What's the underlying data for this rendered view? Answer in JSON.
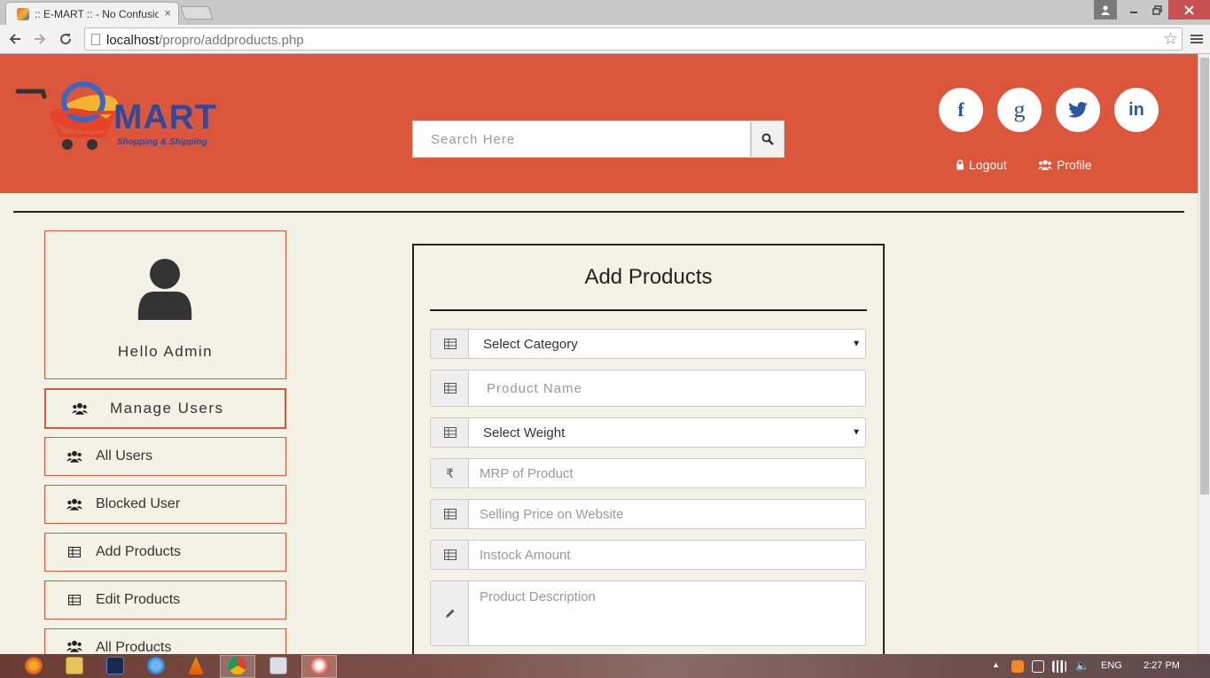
{
  "browser": {
    "tab_title": ":: E-MART :: - No Confusion",
    "tab_close": "×",
    "url_host": "localhost",
    "url_path": "/propro/addproducts.php"
  },
  "header": {
    "logo_text": "MART",
    "logo_tagline": "Shopping & Shipping",
    "search_placeholder": "Search Here",
    "social": {
      "facebook": "f",
      "google": "g",
      "linkedin": "in"
    },
    "logout_label": "Logout",
    "profile_label": "Profile"
  },
  "sidebar": {
    "greeting": "Hello Admin",
    "manage_label": "Manage Users",
    "items": [
      {
        "label": "All Users",
        "icon": "users-icon"
      },
      {
        "label": "Blocked User",
        "icon": "users-icon"
      },
      {
        "label": "Add Products",
        "icon": "table-icon"
      },
      {
        "label": "Edit Products",
        "icon": "table-icon"
      },
      {
        "label": "All Products",
        "icon": "users-icon"
      }
    ]
  },
  "form": {
    "title": "Add Products",
    "category_selected": "Select Category",
    "product_name_placeholder": "Product Name",
    "weight_selected": "Select Weight",
    "mrp_placeholder": "MRP of Product",
    "mrp_addon": "₹",
    "selling_price_placeholder": "Selling Price on Website",
    "instock_placeholder": "Instock Amount",
    "description_placeholder": "Product Description"
  },
  "taskbar": {
    "language": "ENG",
    "time": "2:27 PM"
  },
  "colors": {
    "header_bg": "#dc563b",
    "brand_blue": "#2d4a9e",
    "page_bg": "#f2f3e6",
    "border_accent": "#dc563b"
  }
}
